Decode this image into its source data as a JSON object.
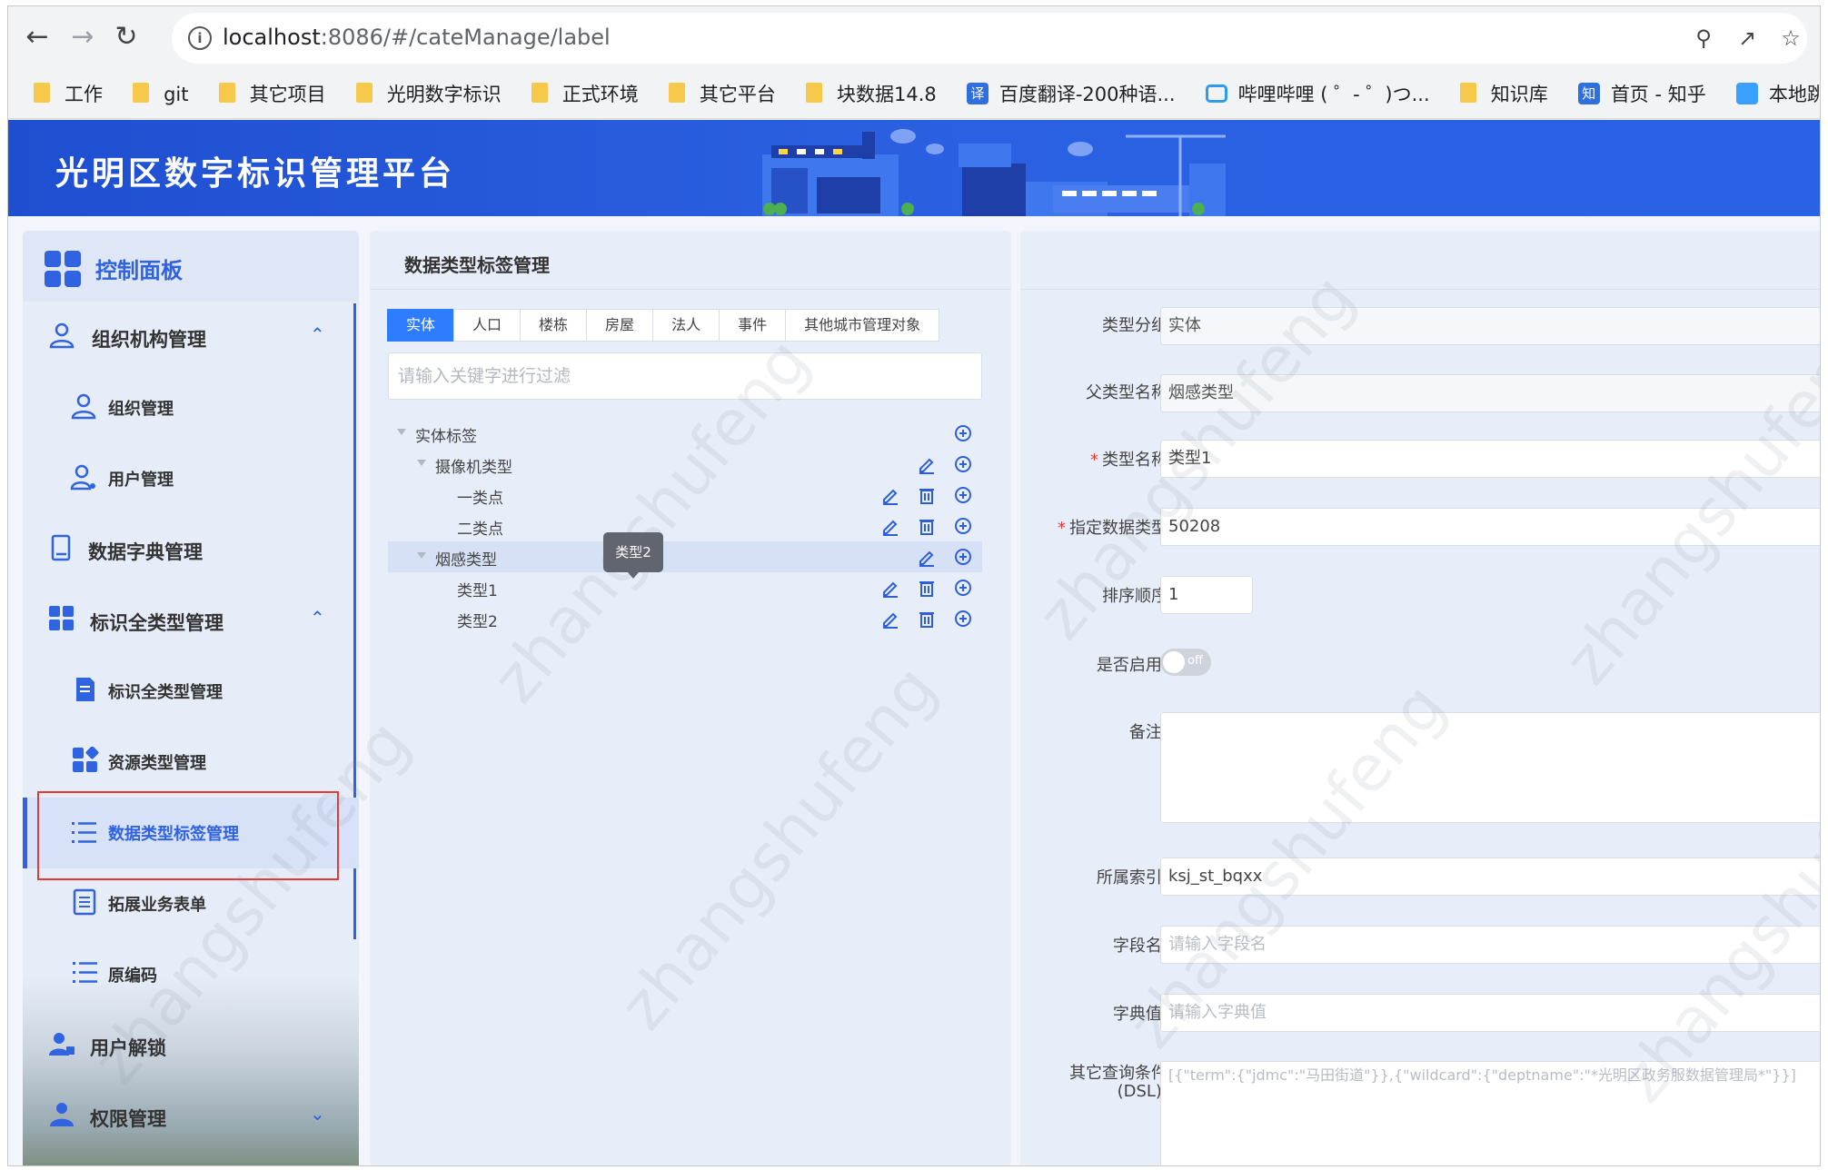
{
  "browser": {
    "url_host": "localhost",
    "url_rest": ":8086/#/cateManage/label",
    "bookmarks": [
      "工作",
      "git",
      "其它项目",
      "光明数字标识",
      "正式环境",
      "其它平台",
      "块数据14.8",
      "百度翻译-200种语...",
      "哔哩哔哩 ( ゜- ゜)つ...",
      "知识库",
      "首页 - 知乎",
      "本地跳转粤政易测试"
    ],
    "bookmark_icon_yi": "译",
    "bookmark_icon_zhi": "知"
  },
  "app": {
    "title": "光明区数字标识管理平台"
  },
  "sidebar": {
    "dashboard": "控制面板",
    "items": [
      {
        "label": "组织机构管理"
      },
      {
        "label": "组织管理"
      },
      {
        "label": "用户管理"
      },
      {
        "label": "数据字典管理"
      },
      {
        "label": "标识全类型管理"
      },
      {
        "label": "标识全类型管理"
      },
      {
        "label": "资源类型管理"
      },
      {
        "label": "数据类型标签管理"
      },
      {
        "label": "拓展业务表单"
      },
      {
        "label": "原编码"
      },
      {
        "label": "用户解锁"
      },
      {
        "label": "权限管理"
      }
    ]
  },
  "middle": {
    "title": "数据类型标签管理",
    "tabs": [
      "实体",
      "人口",
      "楼栋",
      "房屋",
      "法人",
      "事件",
      "其他城市管理对象"
    ],
    "filter_placeholder": "请输入关键字进行过滤",
    "tree": [
      "实体标签",
      "摄像机类型",
      "一类点",
      "二类点",
      "烟感类型",
      "类型1",
      "类型2"
    ],
    "tooltip": "类型2"
  },
  "form": {
    "group_label": "类型分组",
    "group_value": "实体",
    "parent_label": "父类型名称",
    "parent_value": "烟感类型",
    "name_label": "类型名称",
    "name_value": "类型1",
    "datatype_label": "指定数据类型",
    "datatype_value": "50208",
    "order_label": "排序顺序",
    "order_value": "1",
    "enabled_label": "是否启用:",
    "enabled_state": "off",
    "remark_label": "备注:",
    "index_label": "所属索引:",
    "index_value": "ksj_st_bqxx",
    "field_label": "字段名:",
    "field_placeholder": "请输入字段名",
    "dict_label": "字典值:",
    "dict_placeholder": "请输入字典值",
    "dsl_label_1": "其它查询条件",
    "dsl_label_2": "(DSL):",
    "dsl_placeholder": "[{\"term\":{\"jdmc\":\"马田街道\"}},{\"wildcard\":{\"deptname\":\"*光明区政务服数据管理局*\"}}]",
    "required_mark": "*"
  },
  "watermark": "zhangshufeng",
  "colors": {
    "accent": "#2f63e0",
    "tab_active": "#2f7dff",
    "required": "#e53935"
  }
}
